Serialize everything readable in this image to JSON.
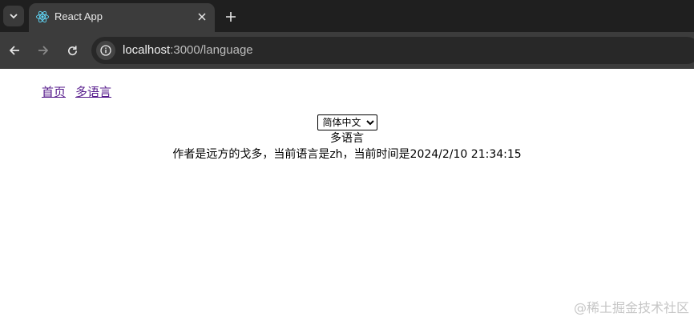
{
  "browser": {
    "tab_title": "React App",
    "url_host": "localhost",
    "url_path": ":3000/language"
  },
  "page": {
    "nav_links": [
      "首页",
      "多语言"
    ],
    "language_select": {
      "selected": "简体中文",
      "options": [
        "简体中文"
      ]
    },
    "heading": "多语言",
    "info": "作者是远方的戈多，当前语言是zh，当前时间是2024/2/10 21:34:15",
    "watermark": "@稀土掘金技术社区"
  },
  "colors": {
    "tabstrip_bg": "#1f1f1f",
    "toolbar_bg": "#3c3c3c",
    "visited_link": "#551a8b",
    "react_logo": "#61dafb"
  },
  "icons": {
    "tab_search": "chevron-down-icon",
    "favicon": "react-logo-icon",
    "tab_close": "close-icon",
    "new_tab": "plus-icon",
    "back": "arrow-left-icon",
    "forward": "arrow-right-icon",
    "reload": "reload-icon",
    "site_info": "info-icon"
  }
}
